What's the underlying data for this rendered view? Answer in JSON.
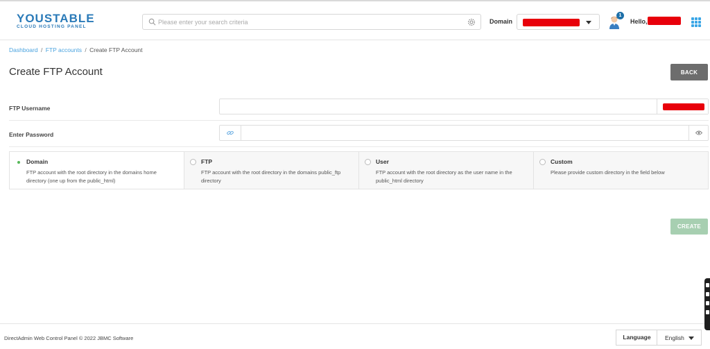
{
  "header": {
    "logo_main": "YOUSTABLE",
    "logo_sub": "CLOUD HOSTING PANEL",
    "search_placeholder": "Please enter your search criteria",
    "domain_label": "Domain",
    "notification_count": "1",
    "hello_label": "Hello,"
  },
  "breadcrumb": {
    "items": [
      "Dashboard",
      "FTP accounts"
    ],
    "current": "Create FTP Account",
    "separator": "/"
  },
  "page": {
    "title": "Create FTP Account",
    "back_label": "BACK",
    "create_label": "CREATE"
  },
  "form": {
    "username_label": "FTP Username",
    "password_label": "Enter Password",
    "username_value": "",
    "password_value": ""
  },
  "options": [
    {
      "title": "Domain",
      "desc": "FTP account with the root directory in the domains home directory (one up from the public_html)",
      "selected": true
    },
    {
      "title": "FTP",
      "desc": "FTP account with the root directory in the domains public_ftp directory",
      "selected": false
    },
    {
      "title": "User",
      "desc": "FTP account with the root directory as the user name in the public_html directory",
      "selected": false
    },
    {
      "title": "Custom",
      "desc": "Please provide custom directory in the field below",
      "selected": false
    }
  ],
  "footer": {
    "copyright": "DirectAdmin Web Control Panel © 2022 JBMC Software",
    "language_label": "Language",
    "language_value": "English"
  },
  "colors": {
    "accent_link": "#4aa3df",
    "back_button": "#6d6d6d",
    "create_button": "#a7cfb1",
    "radio_selected": "#57b859",
    "redacted": "#e8000b"
  }
}
